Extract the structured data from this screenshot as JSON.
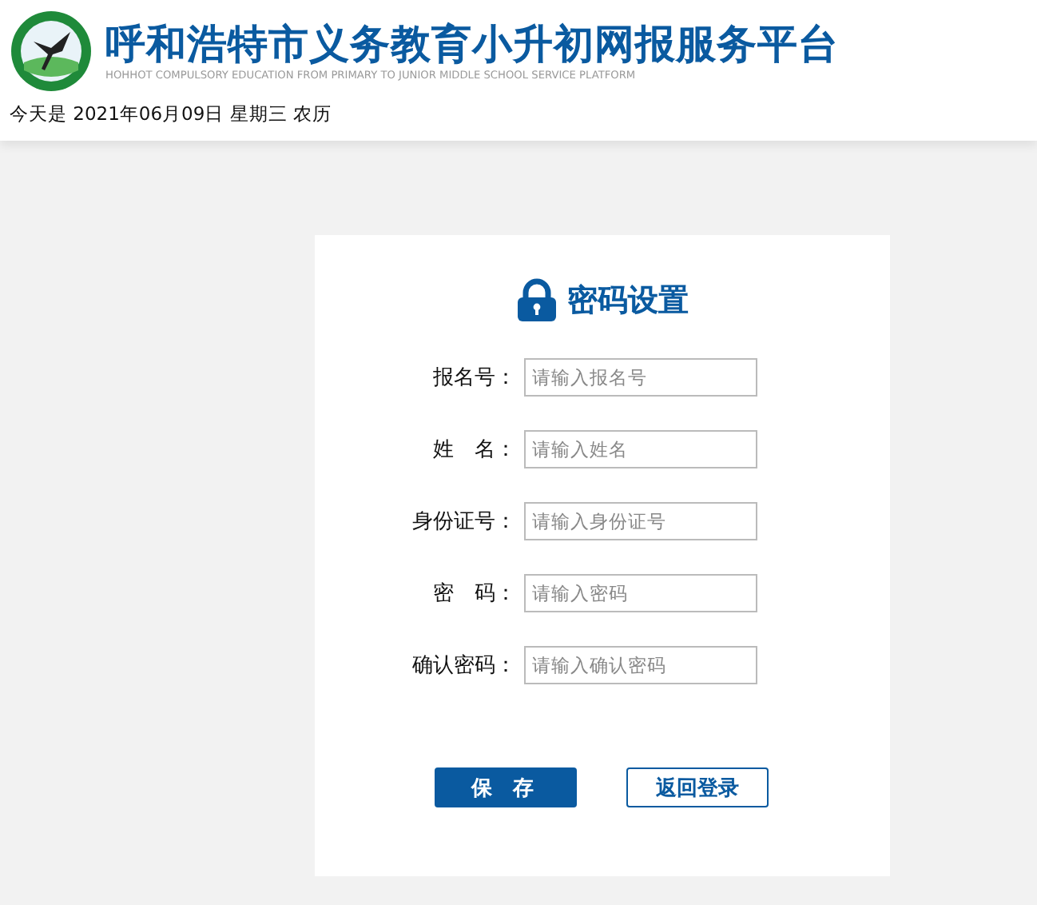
{
  "header": {
    "title": "呼和浩特市义务教育小升初网报服务平台",
    "subtitle": "HOHHOT COMPULSORY EDUCATION FROM PRIMARY TO JUNIOR MIDDLE SCHOOL SERVICE PLATFORM",
    "date_line": "今天是 2021年06月09日 星期三 农历"
  },
  "form": {
    "title": "密码设置",
    "fields": [
      {
        "label": "报名号：",
        "placeholder": "请输入报名号"
      },
      {
        "label": "姓　名：",
        "placeholder": "请输入姓名"
      },
      {
        "label": "身份证号：",
        "placeholder": "请输入身份证号"
      },
      {
        "label": "密　码：",
        "placeholder": "请输入密码"
      },
      {
        "label": "确认密码：",
        "placeholder": "请输入确认密码"
      }
    ],
    "buttons": [
      {
        "label": "保 存",
        "kind": "primary"
      },
      {
        "label": "返回登录",
        "kind": "outline"
      }
    ]
  }
}
